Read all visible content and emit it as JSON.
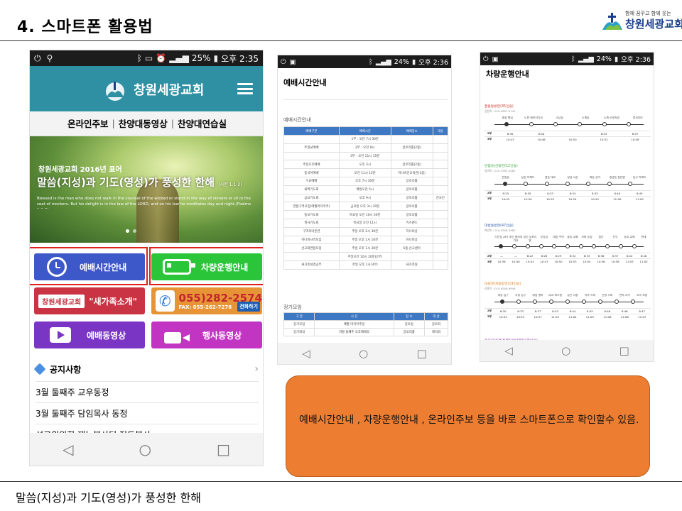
{
  "slide": {
    "title": "4. 스마트폰 활용법",
    "footer": "말씀(지성)과 기도(영성)가 풍성한 한해",
    "logo": {
      "tagline": "함께 꿈꾸고 함께 웃는",
      "name": "창원세광교회"
    }
  },
  "phone1": {
    "status": {
      "battery": "25%",
      "time": "오후 2:35"
    },
    "header": {
      "brand": "창원세광교회"
    },
    "nav": {
      "item1": "온라인주보",
      "item2": "찬양대동영상",
      "item3": "찬양대연습실"
    },
    "banner": {
      "year": "창원세광교회 2016년 표어",
      "motto": "말씀(지성)과 기도(영성)가 풍성한 한해",
      "motto_ref": "(시편 1:1-2)",
      "verse": "Blessed is the man who does not walk in the counsel of the wicked or stand in the way of sinners or sit in the seat of mockers. But his delight is in the law of the LORD, and on his law he meditates day and night.(Psalms 1:1-2)"
    },
    "tiles": {
      "worship": "예배시간안내",
      "bus": "차량운행안내",
      "family": "\"새가족소개\"",
      "family_logo": "창원세광교회",
      "phone": "055)282-2574",
      "fax": "FAX: 055-262-7278",
      "call": "전화하기",
      "video": "예배동영상",
      "event": "행사동영상"
    },
    "notices": {
      "heading": "공지사항",
      "items": [
        "3월 둘째주 교우동정",
        "3월 둘째주 담임목사 동정",
        "선교위원회 재능봉사팀 전도봉사"
      ]
    }
  },
  "phone2": {
    "status": {
      "battery": "24%",
      "time": "오후 2:36"
    },
    "page_title": "예배시간안내",
    "section1": "예배시간안내",
    "headers": [
      "예배구분",
      "예배시간",
      "예배장소",
      "대상"
    ],
    "rows": [
      [
        "",
        "1부 : 오전 7시 30분",
        "",
        ""
      ],
      [
        "주일낮예배",
        "2부 : 오전 9시",
        "글로리홀(2층)",
        ""
      ],
      [
        "",
        "3부 : 오전 11시 15분",
        "",
        ""
      ],
      [
        "주일오후예배",
        "오후 3시",
        "글로리홀(2층)",
        ""
      ],
      [
        "중국어예배",
        "오전 11시 15분",
        "하나비전교육관(1층)",
        ""
      ],
      [
        "수요예배",
        "오후 7시 30분",
        "글로리홀",
        ""
      ],
      [
        "새벽기도회",
        "매일오전 5시",
        "글로리홀",
        ""
      ],
      [
        "금요기도회",
        "오후 9시",
        "글로리홀",
        "전교인"
      ],
      [
        "연합구역모임(매월마지막주)",
        "금요일 오후 3시 30분",
        "글로리홀",
        ""
      ],
      [
        "중보기도회",
        "목요일 오전 10시 30분",
        "글로리홀",
        ""
      ],
      [
        "권사기도회",
        "목요일 오전 11시",
        "키즈랜드",
        ""
      ],
      [
        "구역리더훈련",
        "주일 오후 2시 30분",
        "하나비상",
        ""
      ],
      [
        "하나비사역모임",
        "주일 오후 1시 10분",
        "하나비상",
        ""
      ],
      [
        "선교회연합모임",
        "주일 오후 1시 30분",
        "5층 선교센터",
        ""
      ],
      [
        "",
        "주일오전 10시 20분(2부)",
        "",
        ""
      ],
      [
        "새가족성경공부",
        "주일 오후 1시(3부)",
        "새가족실",
        ""
      ]
    ],
    "section2": "정기모임",
    "headers2": [
      "구 분",
      "시 간",
      "장 소",
      "대 상"
    ],
    "rows2": [
      [
        "장기모임",
        "매월 마지막주일",
        "장로실",
        "장로회"
      ],
      [
        "장기회의",
        "격월 둘째주 오후예배후",
        "글로리홀",
        "제직회"
      ]
    ]
  },
  "phone3": {
    "status": {
      "battery": "24%",
      "time": "오후 2:36"
    },
    "page_title": "차량운행안내",
    "routes": [
      {
        "title": "팔용동방면(35인승)",
        "phone": "김현숙 : 010-4857-5741",
        "stops": [
          "팔용 빵집",
          "도천 빌리지기사",
          "소답동",
          "도계동",
          "도계 로얄사슴",
          "명서다리"
        ],
        "r2": [
          "2부",
          "8:30",
          "8:40",
          "",
          "8:43",
          "8:47"
        ],
        "r3": [
          "3부",
          "10:43",
          "10:46",
          "10:50",
          "10:52",
          "10:58"
        ]
      },
      {
        "title": "반림/남산방면(12인승)",
        "phone": "엄마모 : 010-3597-4462",
        "stops": [
          "반림동",
          "남산 아파트",
          "청동 대로",
          "상남 시장",
          "대동 상가",
          "중앙동 풍년방",
          "동무 아파트"
        ],
        "r2": [
          "2부",
          "8:25",
          "8:30",
          "8:33",
          "8:34",
          "8:35",
          "8:40",
          "8:45"
        ],
        "r3": [
          "3부",
          "10:45",
          "10:50",
          "10:53",
          "10:54",
          "10:55",
          "11:00",
          "11:05"
        ]
      },
      {
        "title": "대방동방면(47인승)",
        "phone": "박만호 : 010-9556-5980",
        "stops": [
          "다인동 APT",
          "조인 빌리지기사",
          "성신 오피스텔",
          "운동장",
          "대방 주택",
          "중동 교회",
          "사파 동성",
          "청운",
          "신익",
          "동호 교회",
          "현대"
        ],
        "r2": [
          "2부",
          "—",
          "—",
          "8:22",
          "8:26",
          "8:29",
          "8:32",
          "8:33",
          "8:36",
          "8:37",
          "8:44",
          "8:46"
        ],
        "r3": [
          "3부",
          "10:36",
          "10:40",
          "10:43",
          "10:47",
          "10:50",
          "10:53",
          "10:54",
          "10:56",
          "10:58",
          "11:03",
          "11:05"
        ]
      },
      {
        "title": "대원/반지동방면(19인승)",
        "phone": "신종기 : 010-9556-6948",
        "stops": [
          "내동 입구",
          "사정 입구",
          "대림 빌라",
          "000 퍼스빌",
          "상진 시청",
          "탁목 스피",
          "탄양 스피",
          "반지 시가",
          "오목 조흥"
        ],
        "r2": [
          "2부",
          "8:30",
          "8:33",
          "8:37",
          "8:43",
          "8:44",
          "8:45",
          "8:46",
          "8:46",
          "8:47"
        ],
        "r3": [
          "3부",
          "10:45",
          "10:55",
          "10:57",
          "11:03",
          "11:04",
          "11:05",
          "11:06",
          "11:06",
          "11:07"
        ]
      },
      {
        "title": "용지/가음정/토월우성아파트(25인승)",
        "phone": "",
        "stops": [],
        "r2": [],
        "r3": []
      }
    ]
  },
  "callout": {
    "text": "예배시간안내 , 자량운행안내 , 온라인주보 등을 바로 스마트폰으로 확인할수 있음."
  },
  "colors": {
    "header_teal": "#2f8fa3",
    "worship_tile": "#3d58c9",
    "bus_tile": "#2bc53a",
    "family_tile": "#c93344",
    "phone_tile": "#e79436",
    "video_tile": "#7b35c5",
    "event_tile": "#c235c2",
    "highlight": "#e0201c",
    "callout": "#ed7d31",
    "table_header": "#3f78c2"
  },
  "icons": {
    "status_left": [
      "usb-icon",
      "android-icon"
    ],
    "status_right": [
      "bluetooth-icon",
      "vibrate-icon",
      "alarm-icon",
      "signal-icon",
      "battery-icon"
    ],
    "navbar": [
      "back-triangle-icon",
      "home-circle-icon",
      "recents-square-icon"
    ]
  }
}
